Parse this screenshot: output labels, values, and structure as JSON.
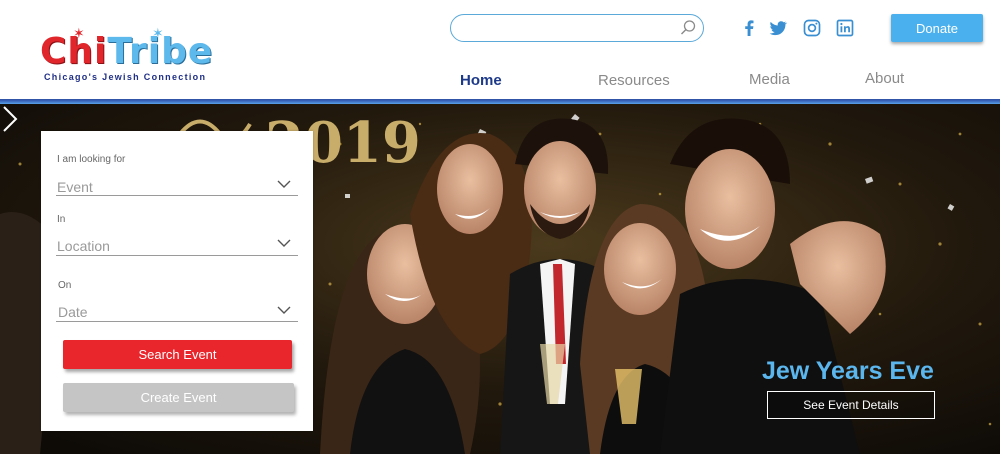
{
  "brand": {
    "logo_part1": "Chi",
    "logo_part2": "Tribe",
    "tagline": "Chicago's Jewish Connection"
  },
  "header": {
    "search": {
      "placeholder": "",
      "value": "",
      "icon": "search-icon"
    },
    "social": [
      {
        "name": "facebook-icon"
      },
      {
        "name": "twitter-icon"
      },
      {
        "name": "instagram-icon"
      },
      {
        "name": "linkedin-icon"
      }
    ],
    "donate_label": "Donate"
  },
  "nav": {
    "items": [
      {
        "label": "Home",
        "active": true
      },
      {
        "label": "Resources",
        "active": false
      },
      {
        "label": "Media",
        "active": false
      },
      {
        "label": "About",
        "active": false
      }
    ]
  },
  "search_panel": {
    "looking_label": "I am looking for",
    "event_value": "Event",
    "in_label": "In",
    "location_value": "Location",
    "on_label": "On",
    "date_value": "Date",
    "search_button": "Search Event",
    "create_button": "Create Event"
  },
  "hero": {
    "year_text": "2019",
    "event_title": "Jew Years Eve",
    "event_button": "See Event Details"
  },
  "colors": {
    "brand_red": "#e0252b",
    "brand_blue": "#5db8ec",
    "nav_active": "#1d3a8a",
    "donate": "#4bb1ee",
    "search_button": "#e8262c",
    "create_button": "#c5c5c5",
    "event_title": "#5bb6ee"
  }
}
